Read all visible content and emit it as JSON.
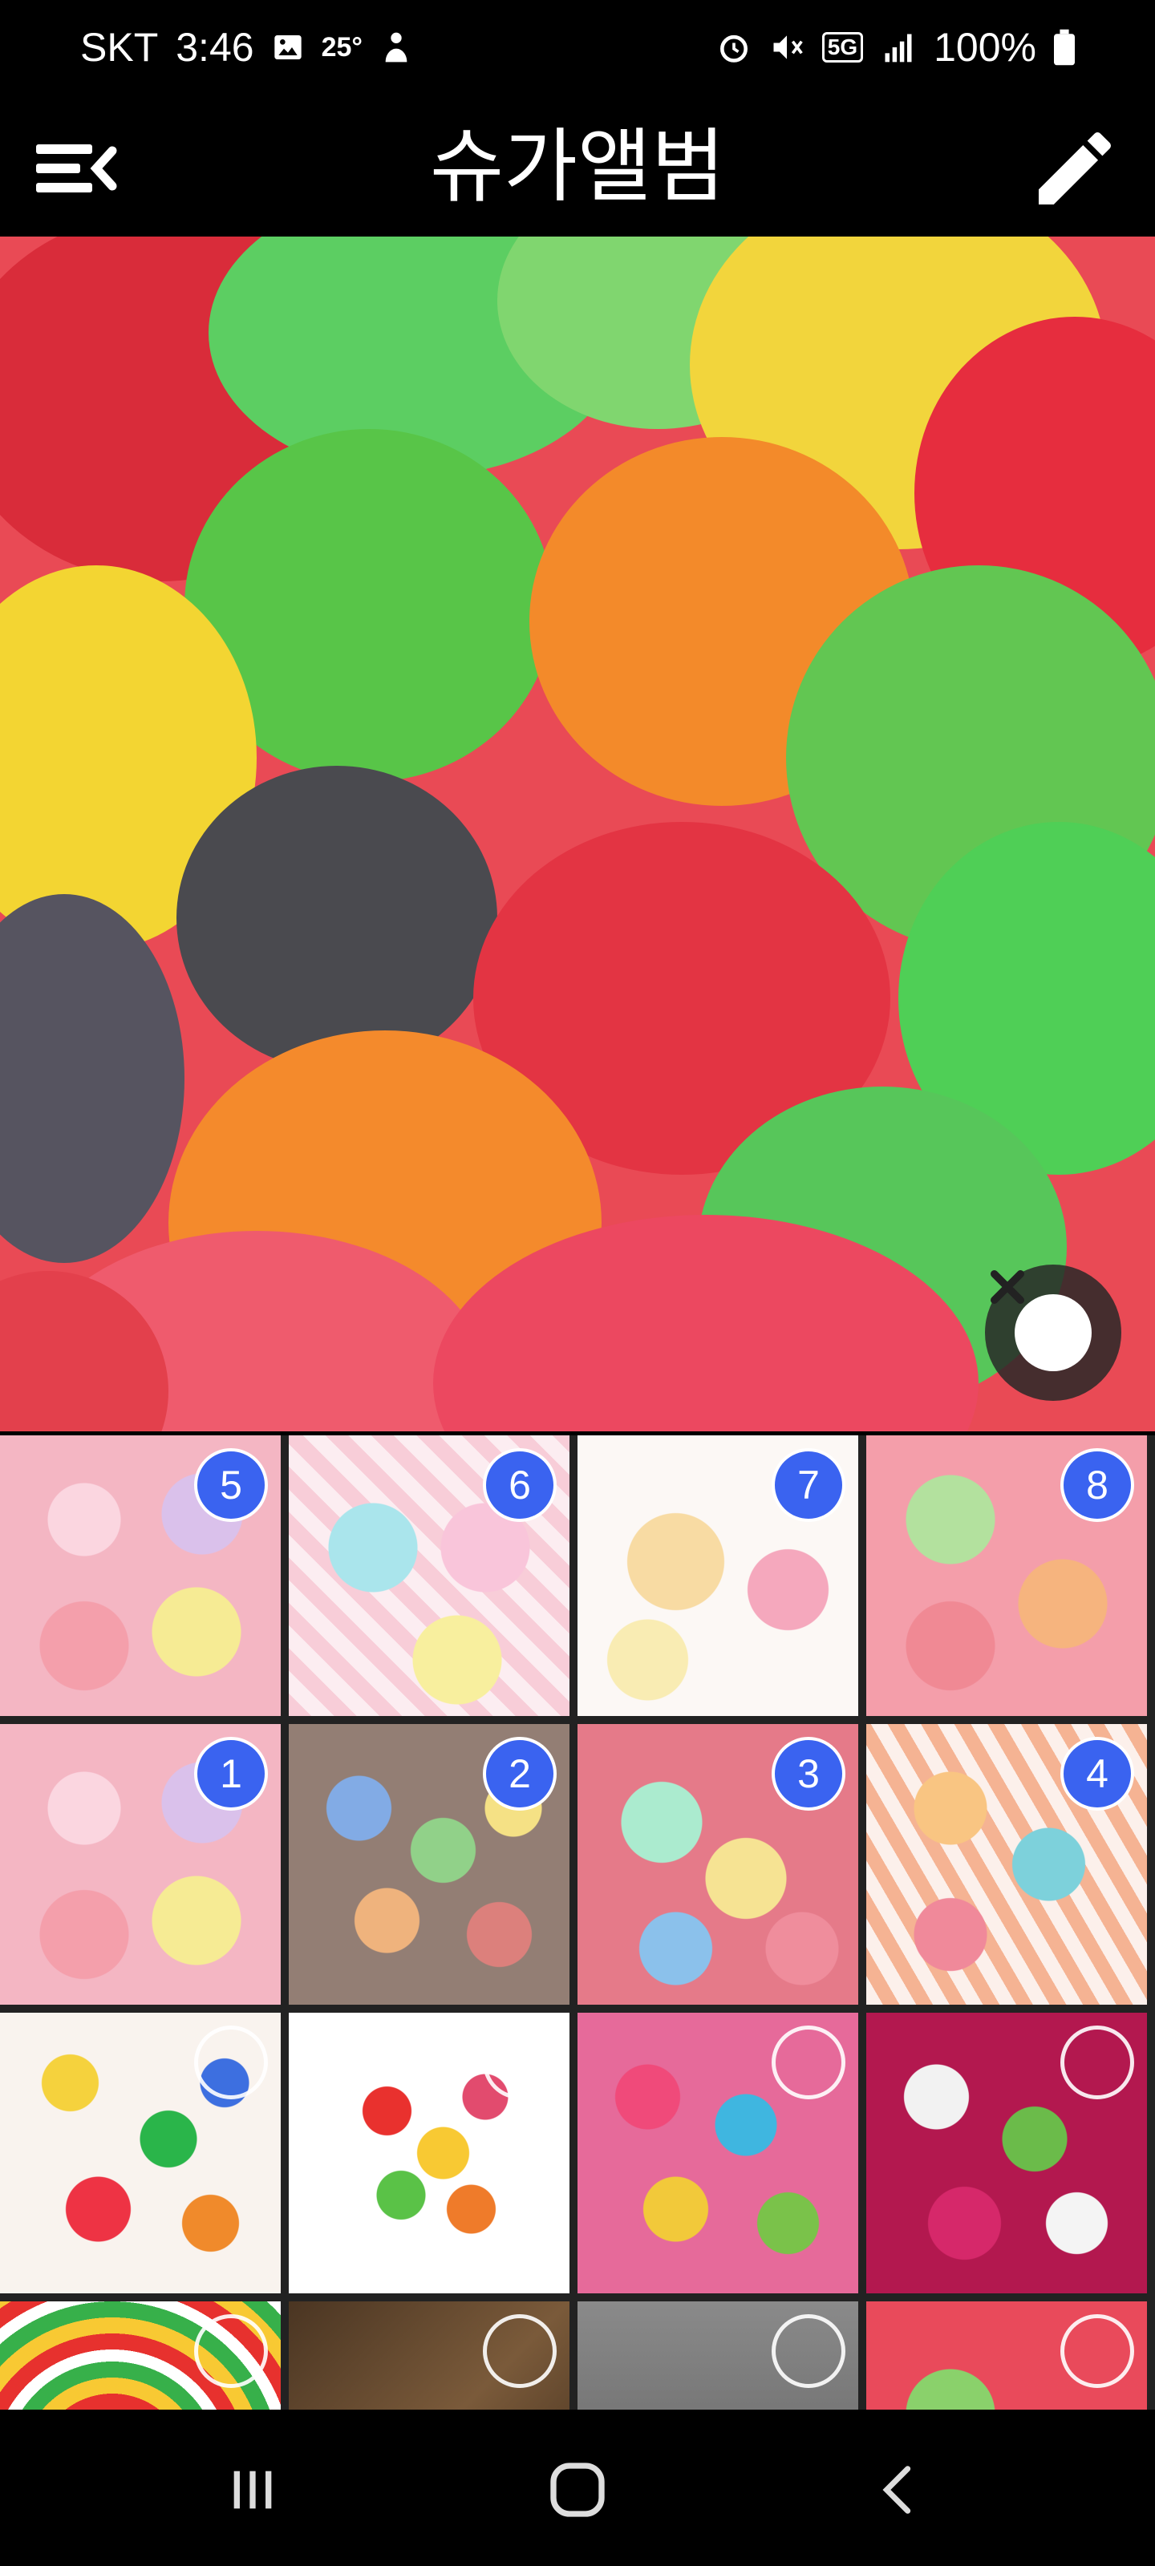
{
  "status_bar": {
    "carrier": "SKT",
    "time": "3:46",
    "temperature": "25°",
    "network": "5G",
    "battery": "100%",
    "icons": [
      "gallery-icon",
      "person-icon",
      "alarm-icon",
      "mute-icon",
      "5g-icon",
      "signal-icon",
      "battery-icon"
    ]
  },
  "app_bar": {
    "title": "슈가앨범",
    "menu_icon": "menu-collapse-icon",
    "edit_icon": "pencil-icon"
  },
  "hero": {
    "close_icon": "close-icon"
  },
  "grid": {
    "tiles": [
      {
        "badge": "5"
      },
      {
        "badge": "6"
      },
      {
        "badge": "7"
      },
      {
        "badge": "8"
      },
      {
        "badge": "1"
      },
      {
        "badge": "2"
      },
      {
        "badge": "3"
      },
      {
        "badge": "4"
      },
      {
        "badge": ""
      },
      {
        "badge": ""
      },
      {
        "badge": ""
      },
      {
        "badge": ""
      },
      {
        "badge": ""
      },
      {
        "badge": ""
      },
      {
        "badge": ""
      },
      {
        "badge": ""
      }
    ]
  },
  "nav_bar": {
    "icons": [
      "recent-apps-icon",
      "home-icon",
      "back-icon"
    ]
  },
  "colors": {
    "badge": "#3a63f0",
    "background": "#000000"
  }
}
